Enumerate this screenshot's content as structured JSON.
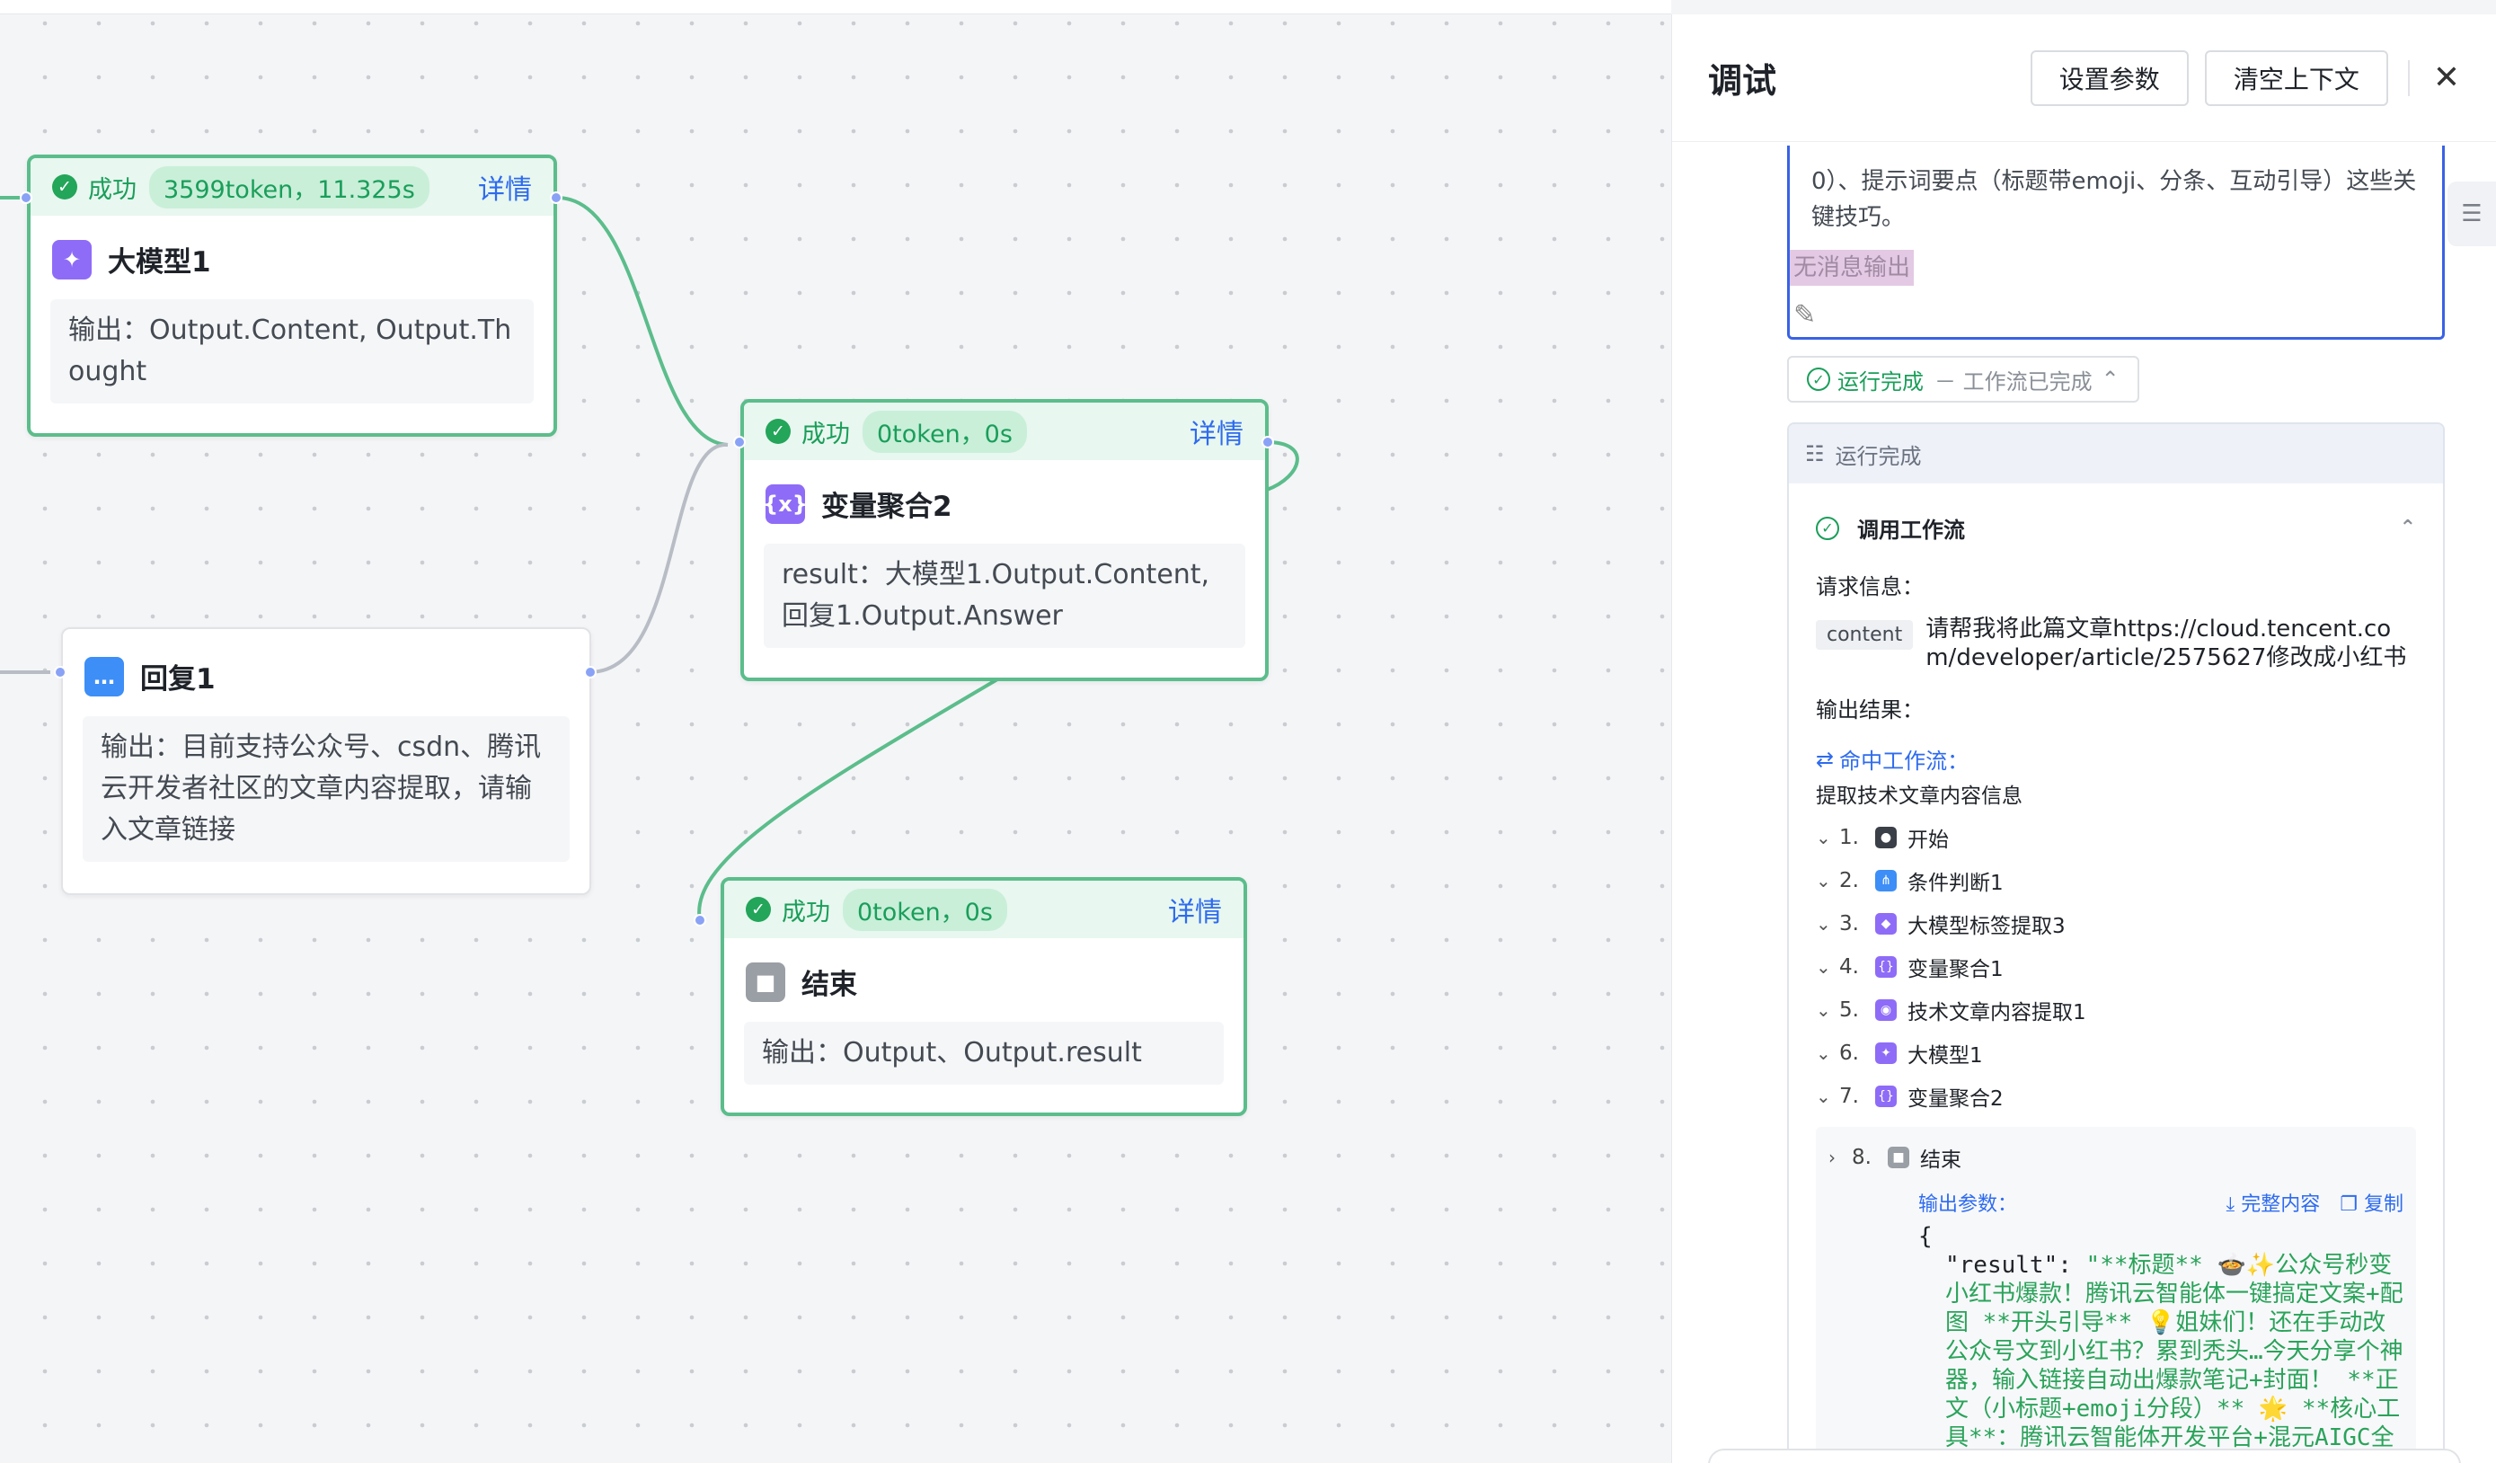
{
  "canvas": {
    "nodes": {
      "llm1": {
        "status": "成功",
        "stats": "3599token，11.325s",
        "detail": "详情",
        "title": "大模型1",
        "body": "输出：Output.Content, Output.Thought"
      },
      "agg2": {
        "status": "成功",
        "stats": "0token，0s",
        "detail": "详情",
        "title": "变量聚合2",
        "body": "result：大模型1.Output.Content, 回复1.Output.Answer"
      },
      "reply1": {
        "title": "回复1",
        "body": "输出：目前支持公众号、csdn、腾讯云开发者社区的文章内容提取，请输入文章链接"
      },
      "end": {
        "status": "成功",
        "stats": "0token，0s",
        "detail": "详情",
        "title": "结束",
        "body": "输出：Output、Output.result"
      }
    }
  },
  "panel": {
    "title": "调试",
    "buttons": {
      "set_params": "设置参数",
      "clear_context": "清空上下文"
    },
    "message": {
      "text": "0）、提示词要点（标题带emoji、分条、互动引导）这些关键技巧。",
      "no_output": "无消息输出"
    },
    "run_badge": {
      "label": "运行完成",
      "sub": "－ 工作流已完成"
    },
    "result": {
      "header": "运行完成",
      "workflow_title": "调用工作流",
      "request_label": "请求信息：",
      "content_tag": "content",
      "content_text": "请帮我将此篇文章https://cloud.tencent.com/developer/article/2575627修改成小红书",
      "output_label": "输出结果：",
      "hit_label": "命中工作流：",
      "hit_name": "提取技术文章内容信息",
      "steps": [
        {
          "num": "1.",
          "name": "开始"
        },
        {
          "num": "2.",
          "name": "条件判断1"
        },
        {
          "num": "3.",
          "name": "大模型标签提取3"
        },
        {
          "num": "4.",
          "name": "变量聚合1"
        },
        {
          "num": "5.",
          "name": "技术文章内容提取1"
        },
        {
          "num": "6.",
          "name": "大模型1"
        },
        {
          "num": "7.",
          "name": "变量聚合2"
        },
        {
          "num": "8.",
          "name": "结束"
        }
      ],
      "output_params": "输出参数：",
      "full_content": "完整内容",
      "copy": "复制",
      "code_open": "{",
      "code_key": "\"result\": ",
      "code_value": "\"**标题** 🍲✨公众号秒变小红书爆款！腾讯云智能体一键搞定文案+配图 **开头引导** 💡姐妹们！还在手动改公众号文到小红书？累到秃头…今天分享个神器，输入链接自动出爆款笔记+封面！ **正文（小标题+emoji分段）** 🌟 **核心工具**：腾讯云智能体开发平台+混元AIGC全家桶 🔍 *"
    }
  }
}
